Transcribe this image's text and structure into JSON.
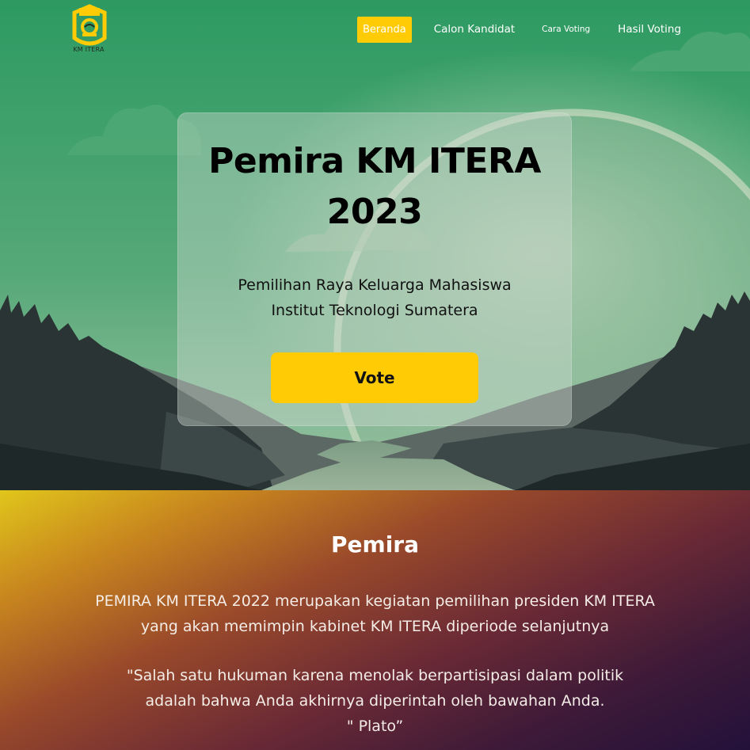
{
  "nav": {
    "logo_text": "KM ITERA",
    "items": [
      {
        "label": "Beranda",
        "active": true
      },
      {
        "label": "Calon Kandidat",
        "active": false
      },
      {
        "label": "Cara Voting",
        "active": false
      },
      {
        "label": "Hasil Voting",
        "active": false
      }
    ]
  },
  "hero": {
    "title_line1": "Pemira KM ITERA",
    "title_line2": "2023",
    "subtitle_line1": "Pemilihan Raya Keluarga Mahasiswa",
    "subtitle_line2": "Institut Teknologi Sumatera",
    "vote_label": "Vote"
  },
  "about": {
    "title": "Pemira",
    "desc_line1": "PEMIRA KM ITERA 2022 merupakan kegiatan pemilihan presiden KM ITERA",
    "desc_line2": "yang akan memimpin kabinet KM ITERA diperiode selanjutnya",
    "quote_line1": "\"Salah satu hukuman karena menolak berpartisipasi dalam politik",
    "quote_line2": "adalah bahwa Anda akhirnya diperintah oleh bawahan Anda.",
    "quote_line3": "\"  Plato”"
  },
  "colors": {
    "accent": "#ffcb05",
    "sky_top": "#2d9a62",
    "sky_bottom": "#7ab48e",
    "mountain_dark": "#212b2b"
  }
}
